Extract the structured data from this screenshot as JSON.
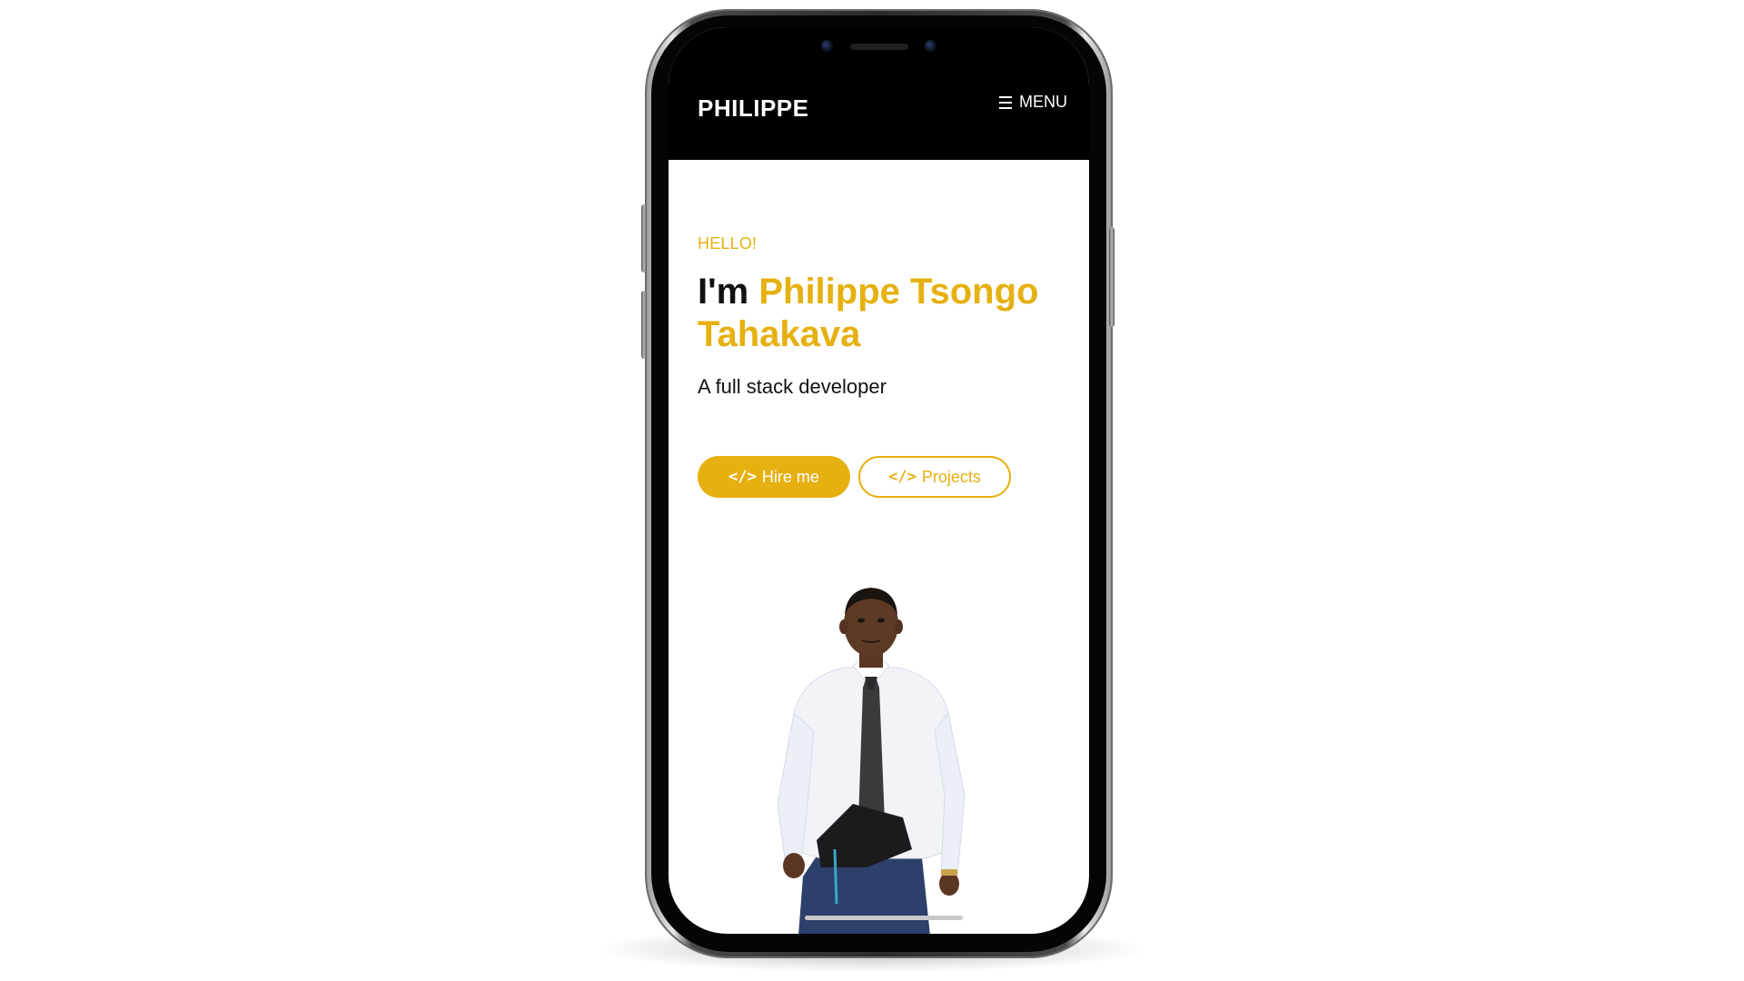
{
  "header": {
    "brand": "PHILIPPE",
    "menu_label": "MENU",
    "menu_icon": "hamburger-icon"
  },
  "hero": {
    "greeting": "HELLO!",
    "intro": "I'm",
    "name": "Philippe Tsongo Tahakava",
    "subtitle": "A full stack developer"
  },
  "buttons": {
    "hire": {
      "label": "Hire me",
      "icon": "code-icon",
      "glyph": "</>"
    },
    "projects": {
      "label": "Projects",
      "icon": "code-icon",
      "glyph": "</>"
    }
  },
  "portrait": {
    "icon": "person-portrait"
  },
  "colors": {
    "accent": "#e6b010",
    "header_bg": "#000000",
    "page_bg": "#ffffff",
    "text": "#111111"
  }
}
